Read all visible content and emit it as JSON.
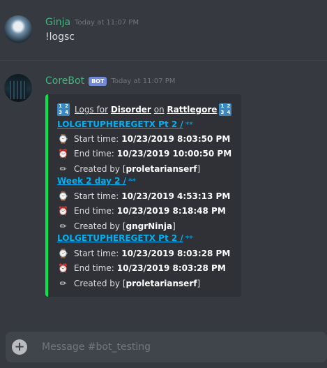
{
  "messages": [
    {
      "author": "Ginja",
      "time": "Today at 11:07 PM",
      "text": "!logsc"
    },
    {
      "author": "CoreBot",
      "bot_tag": "BOT",
      "time": "Today at 11:07 PM",
      "embed": {
        "accent_color": "#00e64d",
        "title": {
          "prefix": "Logs for",
          "guild": "Disorder",
          "on": "on",
          "server": "Rattlegore",
          "icon": "input-numbers-icon"
        },
        "entries": [
          {
            "name": "LOLGETUPHEREGETX Pt 2 /",
            "suffix": "**",
            "start_label": "Start time:",
            "start": "10/23/2019 8:03:50 PM",
            "end_label": "End time:",
            "end": "10/23/2019 10:00:50 PM",
            "created_label": "Created by",
            "creator": "proletarianserf"
          },
          {
            "name": "Week 2 day 2 /",
            "suffix": "**",
            "start_label": "Start time:",
            "start": "10/23/2019 4:53:13 PM",
            "end_label": "End time:",
            "end": "10/23/2019 8:18:48 PM",
            "created_label": "Created by",
            "creator": "gngrNinja"
          },
          {
            "name": "LOLGETUPHEREGETX Pt 2 /",
            "suffix": "**",
            "start_label": "Start time:",
            "start": "10/23/2019 8:03:28 PM",
            "end_label": "End time:",
            "end": "10/23/2019 8:03:28 PM",
            "created_label": "Created by",
            "creator": "proletarianserf"
          }
        ]
      }
    }
  ],
  "composer": {
    "placeholder": "Message #bot_testing"
  },
  "colors": {
    "author_name": "#43b581",
    "link": "#00b0f4",
    "background": "#36393f",
    "embed_bg": "#2f3136"
  }
}
